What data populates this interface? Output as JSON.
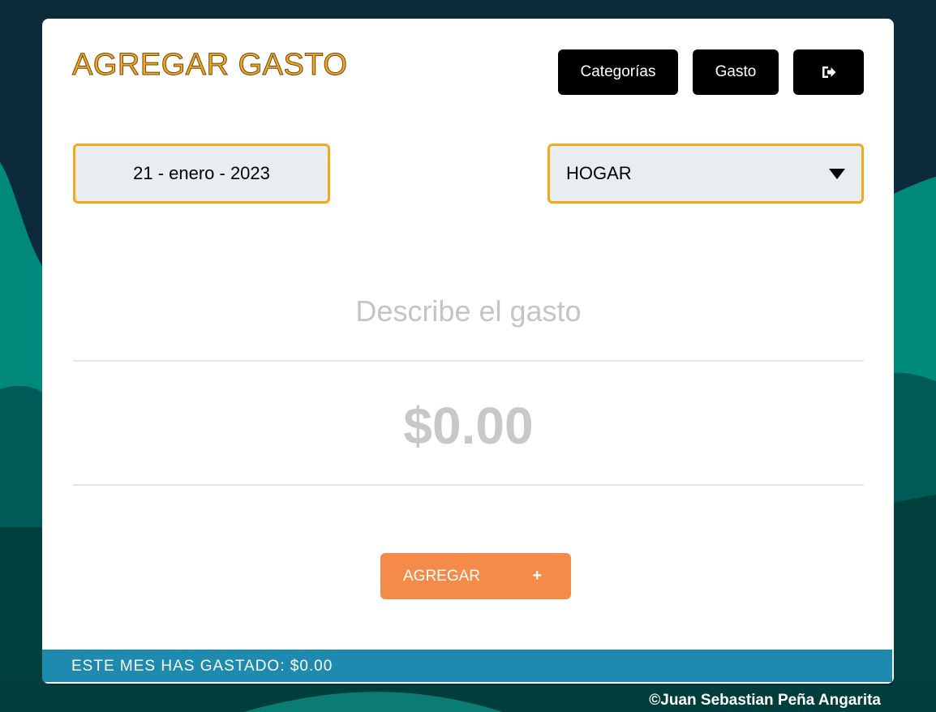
{
  "header": {
    "title": "AGREGAR GASTO",
    "nav": {
      "categorias_label": "Categorías",
      "gasto_label": "Gasto",
      "logout_icon": "logout-icon"
    }
  },
  "form": {
    "date": "21 - enero - 2023",
    "category": "HOGAR",
    "description_placeholder": "Describe el gasto",
    "amount_placeholder": "$0.00",
    "add_label": "AGREGAR",
    "add_symbol": "+"
  },
  "footer": {
    "summary": "ESTE MES HAS GASTADO: $0.00",
    "copyright": "©Juan Sebastian Peña Angarita"
  },
  "colors": {
    "title": "#f5a623",
    "field_border": "#f5a81c",
    "add_button": "#f58b48",
    "footer_bar": "#1f8aaf",
    "background_dark": "#0b2a3a",
    "background_teal": "#00897b"
  }
}
